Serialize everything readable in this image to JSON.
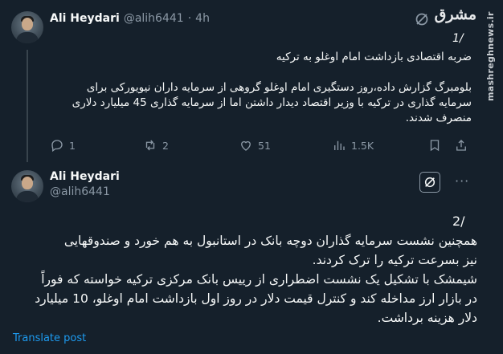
{
  "tweet1": {
    "author_name": "Ali Heydari",
    "handle": "@alih6441",
    "separator": "·",
    "time": "4h",
    "number": "1/",
    "title": "ضربه اقتصادی بازداشت امام اوغلو به ترکیه",
    "body_lines": [
      "بلومبرگ گزارش داده،روز دستگیری امام اوغلو گروهی از سرمایه داران نیویورکی برای",
      "سرمایه گذاری در ترکیه با وزیر اقتصاد دیدار داشتن اما از سرمایه گذاری 45 میلیارد دلاری",
      "منصرف شدند."
    ],
    "actions": {
      "replies": "1",
      "reposts": "2",
      "likes": "51",
      "views": "1.5K"
    }
  },
  "tweet2": {
    "author_name": "Ali Heydari",
    "handle": "@alih6441",
    "number": "2/",
    "body_lines": [
      "همچنین نشست سرمایه گذاران دوچه بانک در استانبول به هم خورد و صندوقهایی",
      "نیز بسرعت ترکیه را ترک کردند.",
      "شیمشک با تشکیل یک نشست اضطراری از رییس بانک مرکزی ترکیه خواسته که فوراً",
      "در بازار ارز مداخله کند و کنترل قیمت دلار در روز اول بازداشت امام اوغلو، 10 میلیارد",
      "دلار هزینه برداشت."
    ],
    "translate_label": "Translate post"
  },
  "watermark": {
    "site": "mashreghnews.ir",
    "logo_text": "مشرق"
  },
  "icons": {
    "grok": "grok-icon",
    "more": "more-icon",
    "reply": "reply-icon",
    "repost": "repost-icon",
    "like": "heart-icon",
    "views": "views-icon",
    "bookmark": "bookmark-icon",
    "share": "share-icon"
  }
}
